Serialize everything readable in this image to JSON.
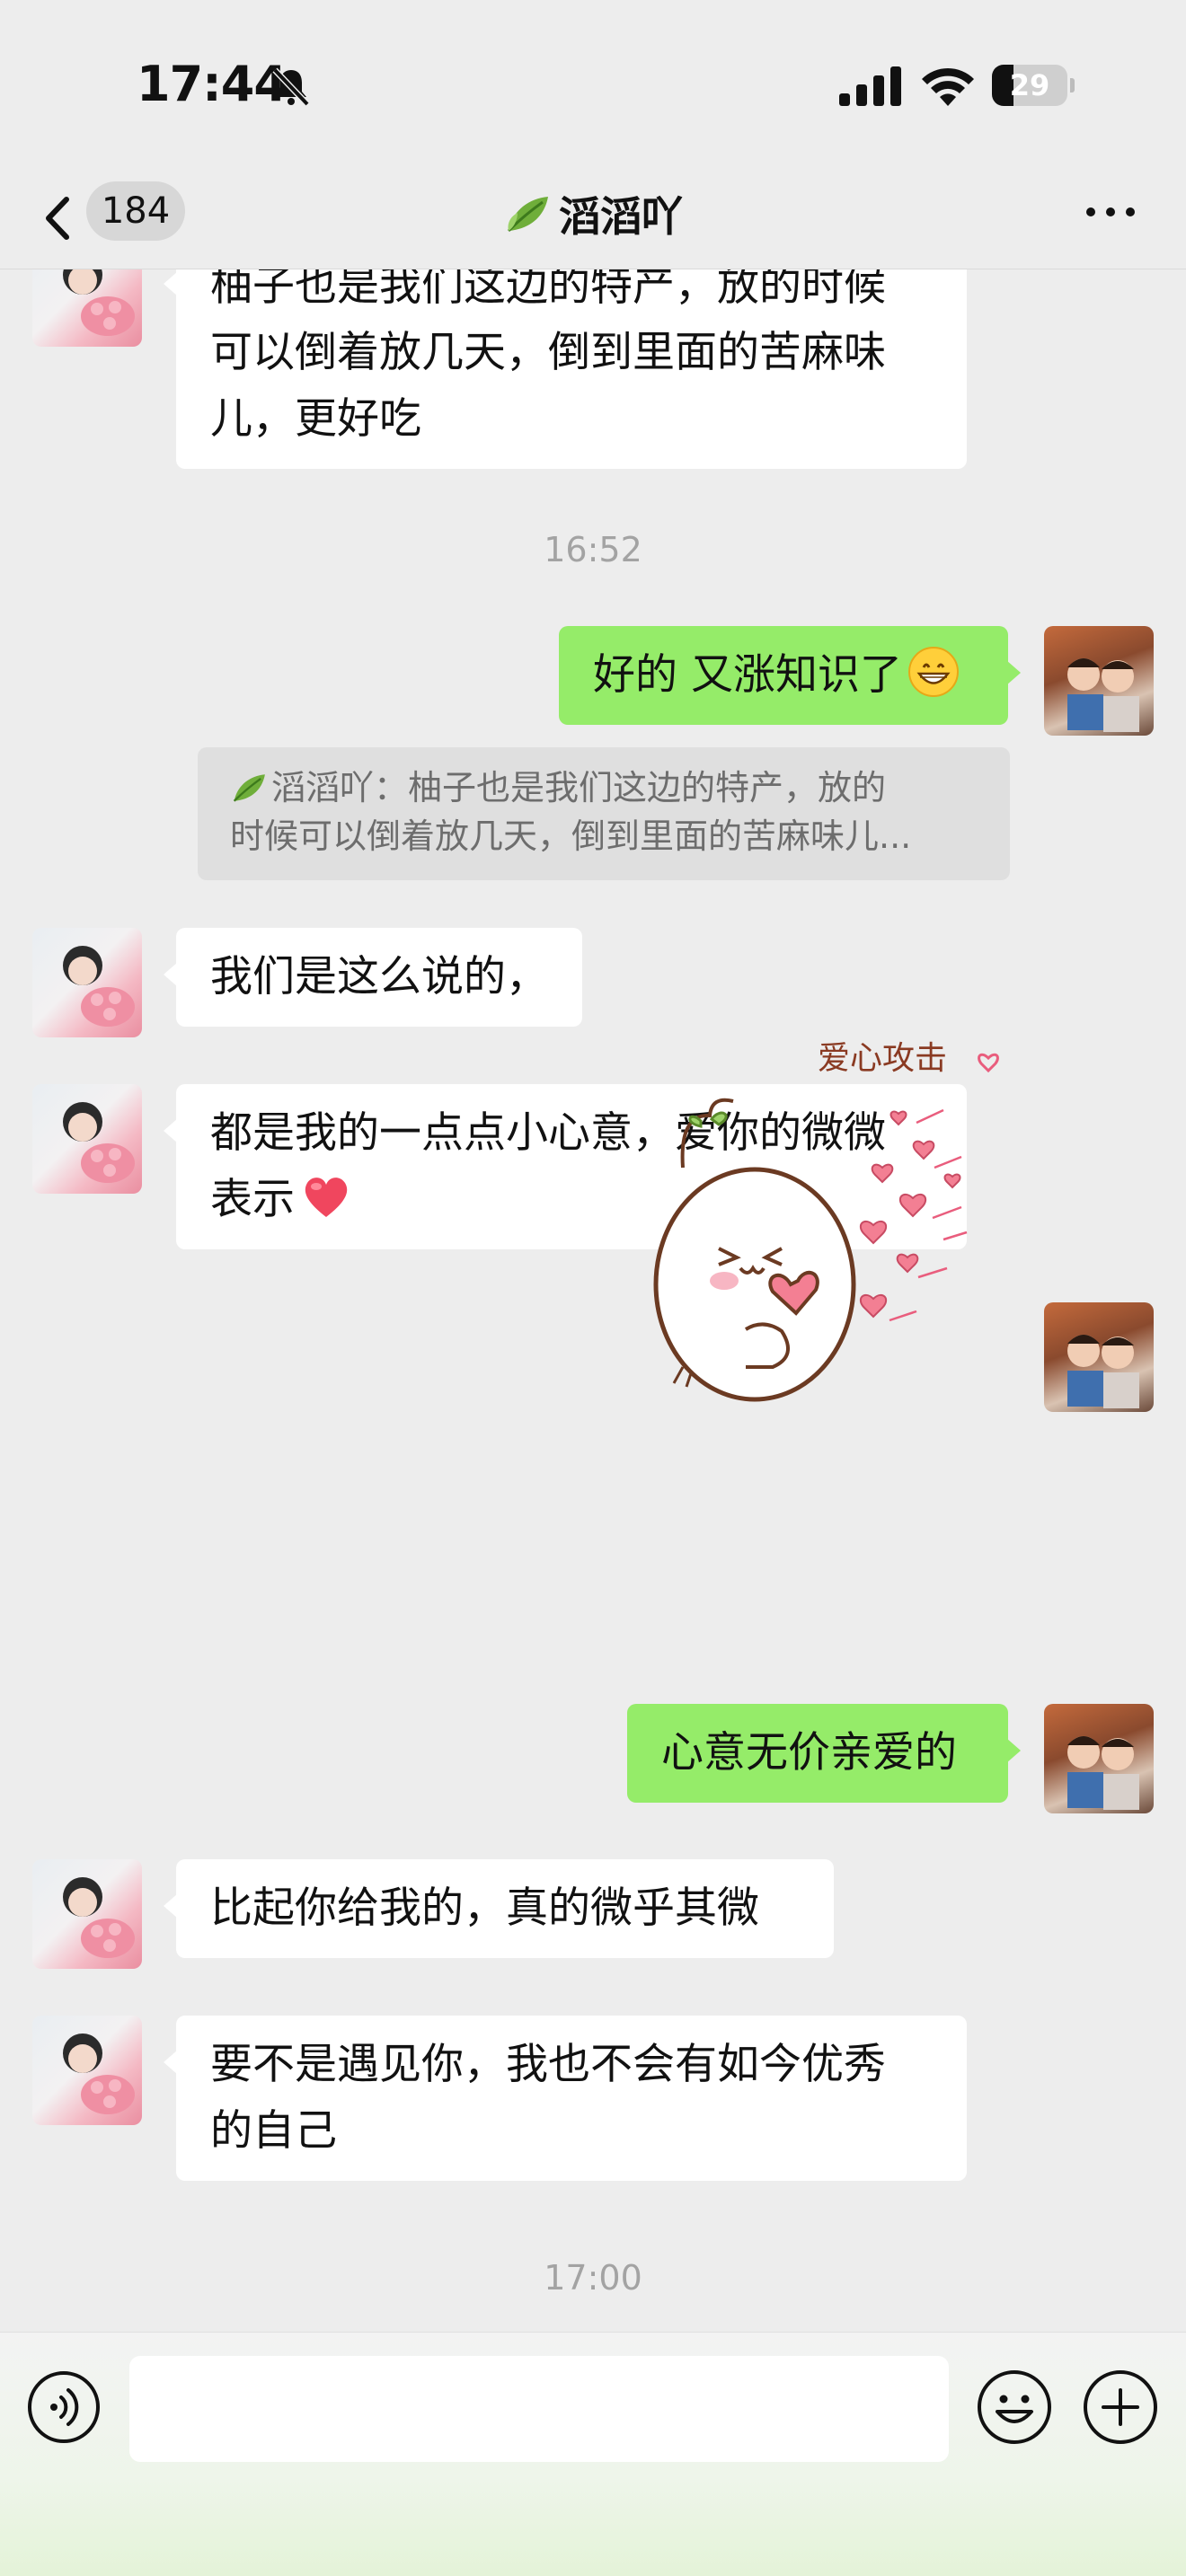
{
  "status_bar": {
    "time": "17:44",
    "battery_level": "29",
    "battery_fraction": 0.29
  },
  "nav": {
    "unread_count": "184",
    "chat_title": "滔滔吖"
  },
  "messages": [
    {
      "id": "m1",
      "sender": "her",
      "text_lines": [
        "柚子也是我们这边的特产，放的时候",
        "可以倒着放几天，倒到里面的苦麻味",
        "儿，更好吃"
      ]
    },
    {
      "id": "t1",
      "type": "time",
      "text": "16:52"
    },
    {
      "id": "m2",
      "sender": "me",
      "text": "好的 又涨知识了",
      "emoji": "grinning-face"
    },
    {
      "id": "q1",
      "type": "quote",
      "lines": [
        "滔滔吖：柚子也是我们这边的特产，放的",
        "时候可以倒着放几天，倒到里面的苦麻味儿..."
      ]
    },
    {
      "id": "m3",
      "sender": "her",
      "text": "我们是这么说的，"
    },
    {
      "id": "m4",
      "sender": "her",
      "text_lines": [
        "都是我的一点点小心意，爱你的微微",
        "表示"
      ],
      "emoji": "red-heart"
    },
    {
      "id": "s1",
      "sender": "me",
      "type": "sticker",
      "caption": "爱心攻击"
    },
    {
      "id": "m5",
      "sender": "me",
      "text": "心意无价亲爱的"
    },
    {
      "id": "m6",
      "sender": "her",
      "text": "比起你给我的，真的微乎其微"
    },
    {
      "id": "m7",
      "sender": "her",
      "text_lines": [
        "要不是遇见你，我也不会有如今优秀",
        "的自己"
      ]
    },
    {
      "id": "t2",
      "type": "time",
      "text": "17:00"
    }
  ],
  "input_bar": {
    "value": "",
    "placeholder": ""
  },
  "colors": {
    "background": "#ededed",
    "outgoing_bubble": "#95ec69",
    "incoming_bubble": "#ffffff",
    "timestamp": "#a3a3a3"
  },
  "icons": [
    "mute-icon",
    "signal-icon",
    "wifi-icon",
    "battery-icon",
    "back-icon",
    "leaf-icon",
    "more-icon",
    "voice-icon",
    "emoji-icon",
    "plus-icon"
  ]
}
